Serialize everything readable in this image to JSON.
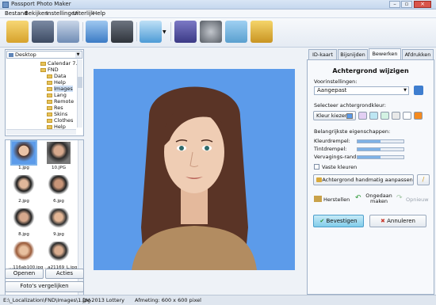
{
  "window": {
    "title": "Passport Photo Maker"
  },
  "menu": [
    "Bestand",
    "Bekijken",
    "Instellingen",
    "Uiterlijk",
    "Help"
  ],
  "toolbar": {
    "icons": [
      "open-folder-icon",
      "save-icon",
      "print-icon",
      "user-icon",
      "camera-icon",
      "photo-enhance-icon",
      "help-book-icon",
      "film-reel-icon",
      "home-globe-icon",
      "shopping-cart-icon"
    ]
  },
  "browser": {
    "drive": "Desktop",
    "tree": [
      {
        "label": "Calendar 7.0"
      },
      {
        "label": "FND"
      },
      {
        "label": "Data"
      },
      {
        "label": "Help"
      },
      {
        "label": "Images"
      },
      {
        "label": "Lang"
      },
      {
        "label": "Remote"
      },
      {
        "label": "Res"
      },
      {
        "label": "Skins"
      },
      {
        "label": "Clothes"
      },
      {
        "label": "Help"
      }
    ],
    "thumbnails": [
      {
        "caption": "1.jpg"
      },
      {
        "caption": "10.JPG"
      },
      {
        "caption": "2.jpg"
      },
      {
        "caption": "6.jpg"
      },
      {
        "caption": "8.jpg"
      },
      {
        "caption": "9.jpg"
      },
      {
        "caption": "...116ab100.jpg"
      },
      {
        "caption": "...a21169_L.jpg"
      }
    ],
    "open_label": "Openen",
    "actions_label": "Acties",
    "compare_label": "Foto's vergelijken"
  },
  "tabs": [
    "ID-kaart",
    "Bijsnijden",
    "Bewerken",
    "Afdrukken"
  ],
  "panel": {
    "title": "Achtergrond wijzigen",
    "presets_label": "Voorinstellingen:",
    "preset_value": "Aangepast",
    "bgcolor_label": "Selecteer achtergrondkleur:",
    "choose_color": "Kleur kiezen",
    "properties_label": "Belangrijkste eigenschappen:",
    "threshold": "Kleurdrempel:",
    "tint": "Tintdrempel:",
    "blur": "Vervagings-rand:",
    "solid": "Vaste kleuren",
    "manual": "Achtergrond handmatig aanpassen",
    "restore": "Herstellen",
    "undo": "Ongedaan maken",
    "redo": "Opnieuw",
    "confirm": "Bevestigen",
    "cancel": "Annuleren"
  },
  "sliders": {
    "threshold": 0.5,
    "tint": 0.5,
    "blur": 0.5
  },
  "swatch_colors": [
    "#5b9bea",
    "#e3cff3",
    "#bde6f3",
    "#d3f2e3",
    "#e9e9e9",
    "#ffffff",
    "#f58a1e"
  ],
  "status": {
    "path": "E:\\_Localization\\FND\\Images\\1.jpg",
    "mode": "DV-2013 Lottery",
    "size": "Afmeting: 600 x 600 pixel"
  }
}
